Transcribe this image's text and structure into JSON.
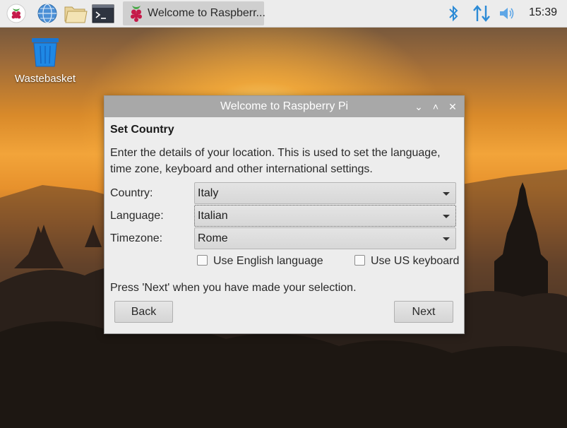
{
  "taskbar": {
    "launchers": [
      "raspberry-menu",
      "web-browser",
      "file-manager",
      "terminal"
    ],
    "active_task": "Welcome to Raspberr...",
    "clock": "15:39",
    "tray": [
      "bluetooth-icon",
      "network-icon",
      "volume-icon"
    ]
  },
  "desktop": {
    "icons": [
      {
        "label": "Wastebasket"
      }
    ]
  },
  "dialog": {
    "title": "Welcome to Raspberry Pi",
    "heading": "Set Country",
    "description": "Enter the details of your location. This is used to set the language, time zone, keyboard and other international settings.",
    "fields": {
      "country": {
        "label": "Country:",
        "value": "Italy"
      },
      "language": {
        "label": "Language:",
        "value": "Italian"
      },
      "timezone": {
        "label": "Timezone:",
        "value": "Rome"
      }
    },
    "checkboxes": {
      "english": {
        "label": "Use English language",
        "checked": false
      },
      "us_keyboard": {
        "label": "Use US keyboard",
        "checked": false
      }
    },
    "note": "Press 'Next' when you have made your selection.",
    "back_label": "Back",
    "next_label": "Next"
  },
  "colors": {
    "titlebar": "#a8a8a8",
    "bluetooth": "#2c8bd6",
    "taskbar": "#ececec"
  }
}
